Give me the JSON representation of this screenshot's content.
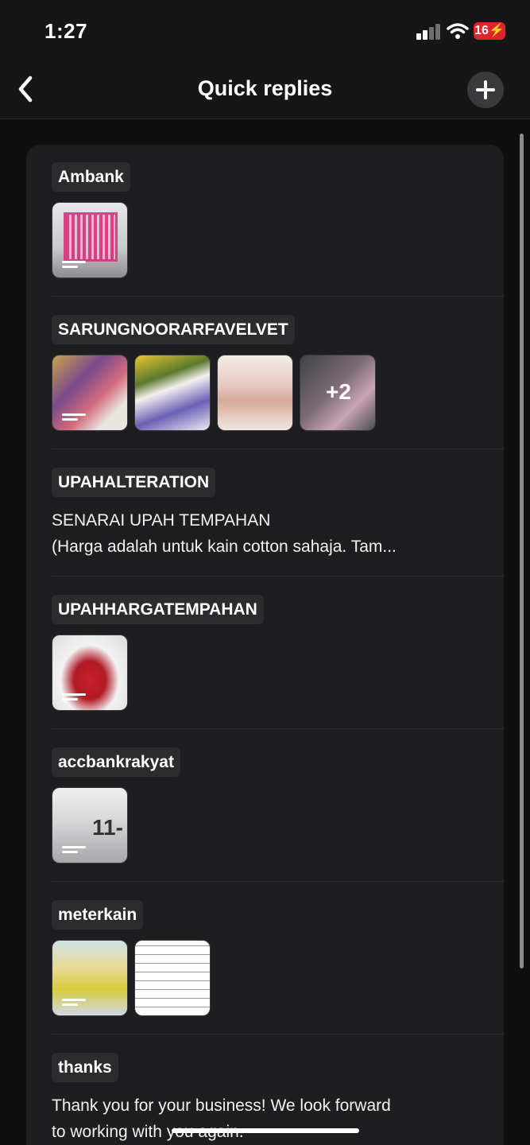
{
  "status_bar": {
    "time": "1:27",
    "battery": "16"
  },
  "nav": {
    "title": "Quick replies"
  },
  "replies": [
    {
      "shortcut": "Ambank"
    },
    {
      "shortcut": "SARUNGNOORARFAVELVET",
      "more": "+2"
    },
    {
      "shortcut": "UPAHALTERATION",
      "text": "SENARAI UPAH TEMPAHAN",
      "text2": "(Harga adalah untuk kain cotton sahaja. Tam..."
    },
    {
      "shortcut": "UPAHHARGATEMPAHAN"
    },
    {
      "shortcut": "accbankrakyat",
      "thumb_text": "11-"
    },
    {
      "shortcut": "meterkain"
    },
    {
      "shortcut": "thanks",
      "text": "Thank you for your business! We look forward",
      "text2": "to working with you again."
    }
  ]
}
